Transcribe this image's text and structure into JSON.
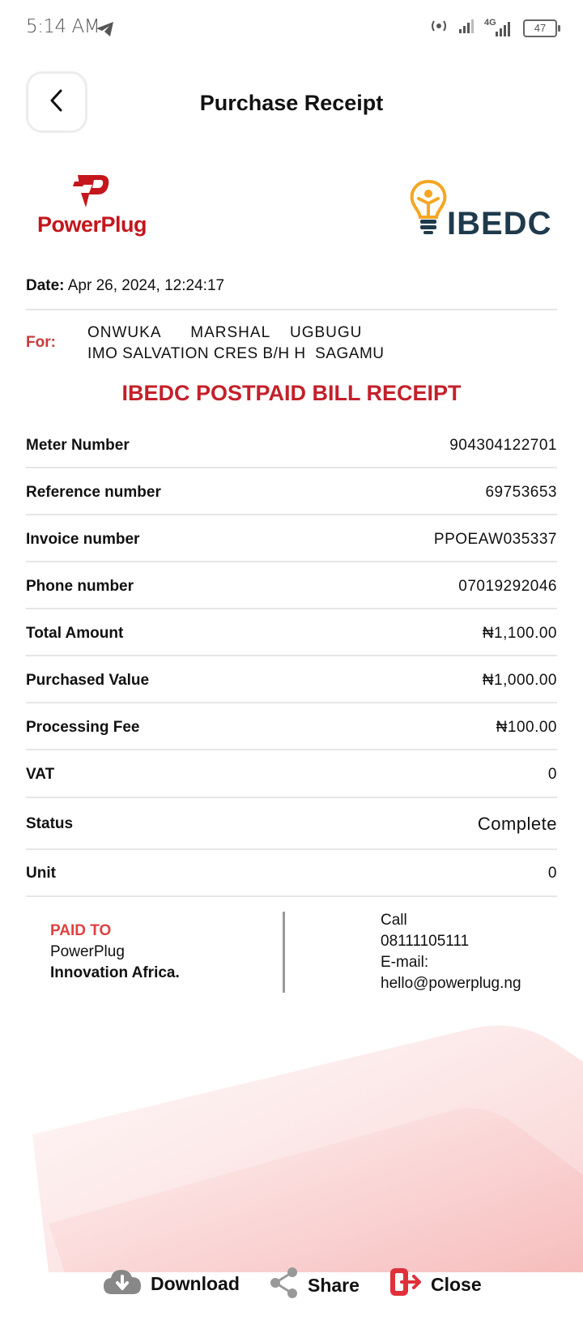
{
  "status_bar": {
    "time": "5:14 AM",
    "network_label": "4G",
    "battery": "47"
  },
  "header": {
    "title": "Purchase Receipt"
  },
  "logos": {
    "left": "PowerPlug",
    "right": "IBEDC"
  },
  "date": {
    "label": "Date:",
    "value": "Apr 26, 2024, 12:24:17"
  },
  "customer": {
    "label": "For:",
    "name": "ONWUKA   MARSHAL  UGBUGU",
    "address": "IMO SALVATION CRES B/H H  SAGAMU"
  },
  "receipt_title": "IBEDC POSTPAID BILL RECEIPT",
  "details": [
    {
      "label": "Meter Number",
      "value": "904304122701"
    },
    {
      "label": "Reference number",
      "value": "69753653"
    },
    {
      "label": "Invoice number",
      "value": "PPOEAW035337"
    },
    {
      "label": "Phone number",
      "value": "07019292046"
    },
    {
      "label": "Total Amount",
      "value": "₦1,100.00"
    },
    {
      "label": "Purchased Value",
      "value": "₦1,000.00"
    },
    {
      "label": "Processing Fee",
      "value": "₦100.00"
    },
    {
      "label": "VAT",
      "value": "0"
    },
    {
      "label": "Status",
      "value": "Complete"
    },
    {
      "label": "Unit",
      "value": "0"
    }
  ],
  "paid_to": {
    "label": "PAID TO",
    "name": "PowerPlug",
    "org": "Innovation Africa."
  },
  "contact": {
    "call_label": "Call",
    "phone": "08111105111",
    "email_label": "E-mail:",
    "email": "hello@powerplug.ng"
  },
  "actions": {
    "download": "Download",
    "share": "Share",
    "close": "Close"
  },
  "colors": {
    "brand_red": "#c4202a",
    "ibedc_navy": "#1f3a4c",
    "ibedc_gold": "#f5a623"
  }
}
